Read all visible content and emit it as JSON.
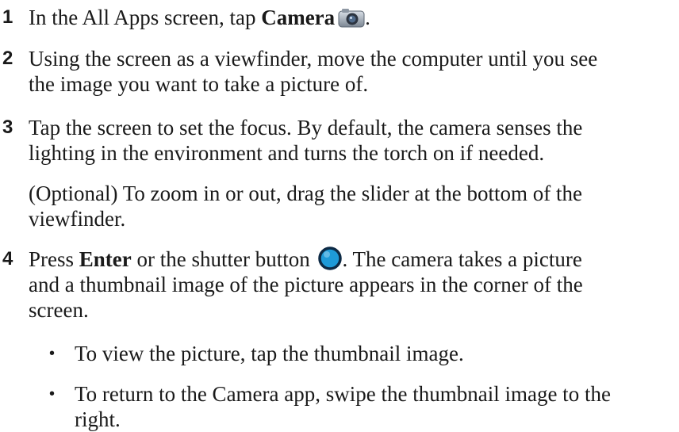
{
  "steps": [
    {
      "num": "1",
      "pre": "In the All Apps screen, tap ",
      "bold": "Camera",
      "post": ".",
      "icon": "camera-icon"
    },
    {
      "num": "2",
      "line1": "Using the screen as a viewfinder, move the computer until you see",
      "line2": "the image you want to take a picture of."
    },
    {
      "num": "3",
      "line1": "Tap the screen to set the focus. By default, the camera senses the",
      "line2": "lighting in the environment and turns the torch on if needed."
    },
    {
      "num": "4",
      "pre": "Press ",
      "bold": "Enter",
      "mid": " or the shutter button ",
      "post": ". The camera takes a picture",
      "line2": "and a thumbnail image of the picture appears in the corner of the",
      "line3": "screen.",
      "icon": "shutter-icon"
    }
  ],
  "optional": {
    "line1": "(Optional) To zoom in or out, drag the slider at the bottom of the",
    "line2": "viewfinder."
  },
  "bullets": [
    {
      "marker": "•",
      "line1": "To view the picture, tap the thumbnail image."
    },
    {
      "marker": "•",
      "line1": "To return to the Camera app, swipe the thumbnail image to the",
      "line2": "right."
    }
  ],
  "colors": {
    "text": "#1a1a1a",
    "shutter": "#1e9ad8"
  }
}
